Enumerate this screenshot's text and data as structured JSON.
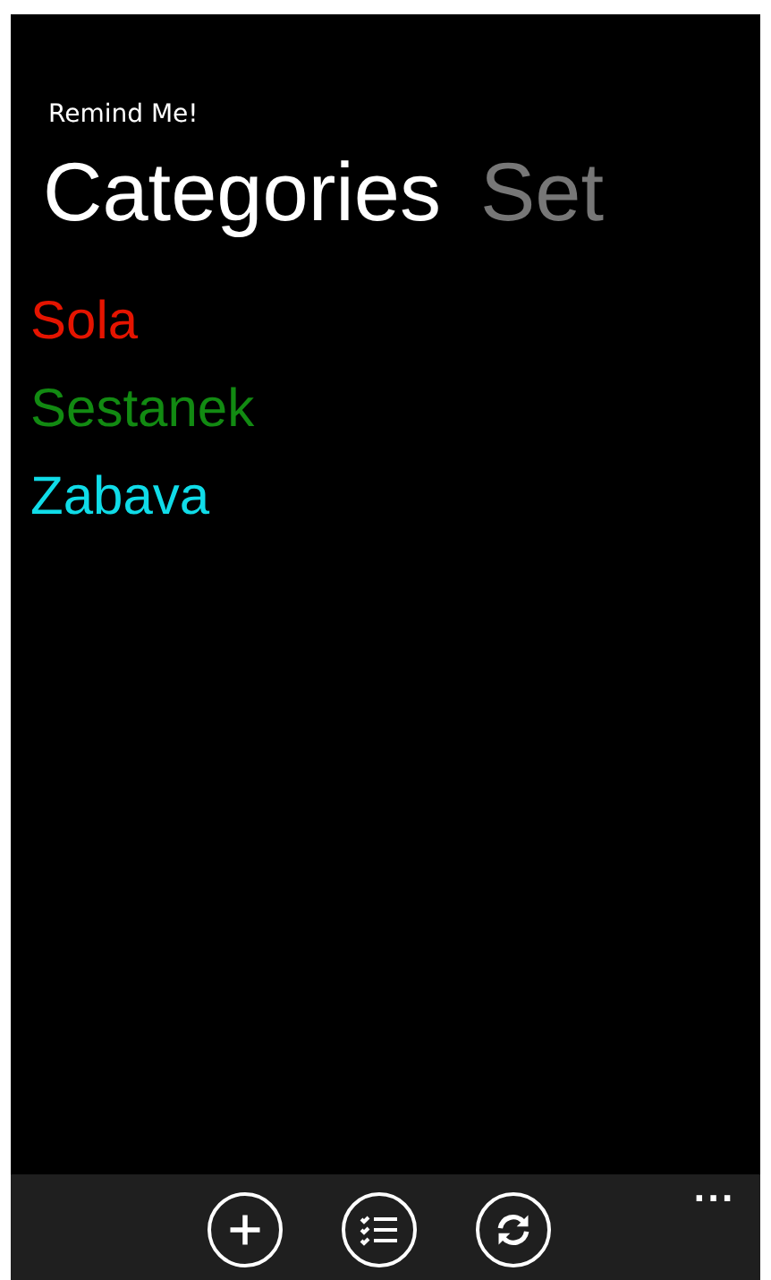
{
  "app_title": "Remind Me!",
  "pivot_headers": [
    {
      "label": "Categories",
      "selected": true
    },
    {
      "label": "Set",
      "selected": false
    }
  ],
  "categories": [
    {
      "name": "Sola",
      "color": "#e51400"
    },
    {
      "name": "Sestanek",
      "color": "#128a12"
    },
    {
      "name": "Zabava",
      "color": "#10dce8"
    }
  ],
  "app_bar": {
    "buttons": [
      {
        "kind": "add"
      },
      {
        "kind": "list"
      },
      {
        "kind": "refresh"
      }
    ],
    "more": "..."
  }
}
